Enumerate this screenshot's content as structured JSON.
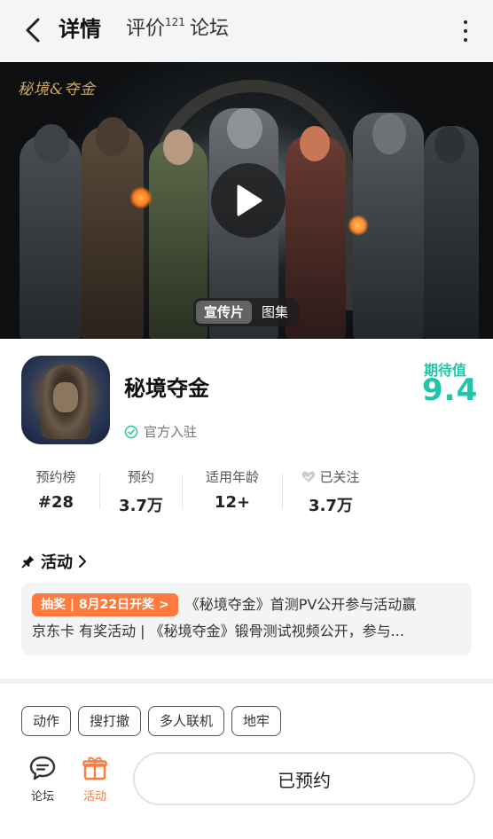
{
  "header": {
    "tabs": [
      {
        "label": "详情"
      },
      {
        "label": "评价",
        "badge": "121"
      },
      {
        "label": "论坛"
      }
    ],
    "accent_color": "#20d3b6",
    "icons": [
      "chevron-left-icon",
      "more-vertical-icon"
    ]
  },
  "hero": {
    "logo_text": "秘境&夺金",
    "media_tabs": [
      "宣传片",
      "图集"
    ],
    "selected_media": "宣传片"
  },
  "app": {
    "name": "秘境夺金",
    "official_label": "官方入驻",
    "expect_label": "期待值",
    "expect_score": "9.4"
  },
  "stats": [
    {
      "label": "预约榜",
      "value": "#28"
    },
    {
      "label": "预约",
      "value": "3.7万"
    },
    {
      "label": "适用年龄",
      "value": "12+"
    },
    {
      "label": "已关注",
      "value": "3.7万"
    }
  ],
  "activity": {
    "title": "活动",
    "badge": "抽奖 | 8月22日开奖 >",
    "line1": "《秘境夺金》首测PV公开参与活动赢",
    "line2": "京东卡 有奖活动 | 《秘境夺金》锻骨测试视频公开，参与..."
  },
  "tags": [
    "动作",
    "搜打撤",
    "多人联机",
    "地牢"
  ],
  "bottom": {
    "forum_label": "论坛",
    "activity_label": "活动",
    "reserve_label": "已预约",
    "activity_color": "#ff7a3c"
  }
}
